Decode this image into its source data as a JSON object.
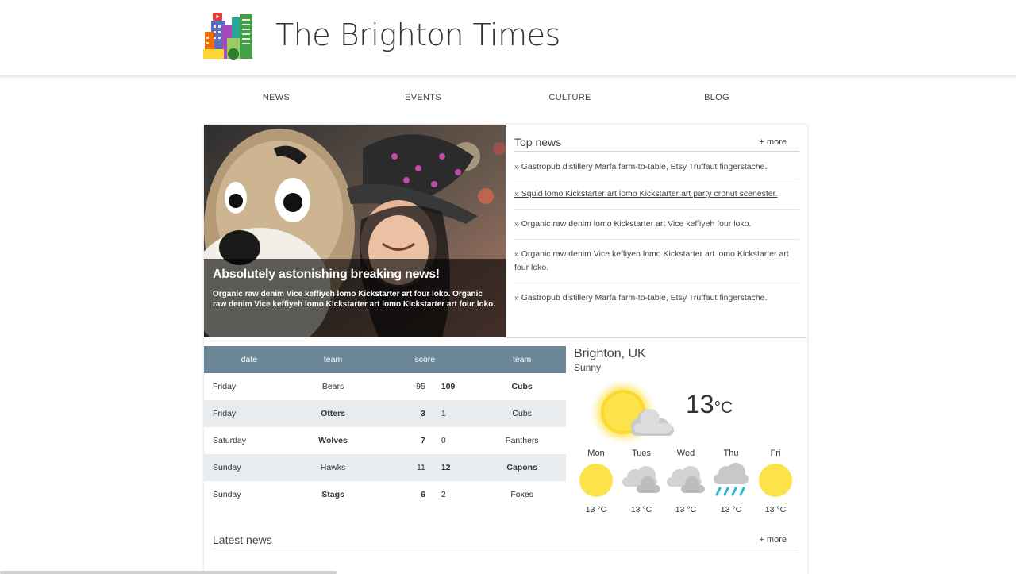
{
  "site": {
    "title": "The Brighton Times"
  },
  "nav": [
    {
      "label": "NEWS"
    },
    {
      "label": "EVENTS"
    },
    {
      "label": "CULTURE"
    },
    {
      "label": "BLOG"
    }
  ],
  "hero": {
    "title": "Absolutely astonishing breaking news!",
    "text": "Organic raw denim Vice keffiyeh lomo Kickstarter art four loko. Organic raw denim Vice keffiyeh lomo Kickstarter art lomo Kickstarter art four loko."
  },
  "top_news": {
    "title": "Top news",
    "more": "+ more",
    "items": [
      {
        "text": "» Gastropub distillery Marfa farm-to-table, Etsy Truffaut fingerstache."
      },
      {
        "text": "» Squid lomo Kickstarter art lomo Kickstarter art party cronut scenester."
      },
      {
        "text": "» Organic raw denim lomo Kickstarter art Vice keffiyeh four loko."
      },
      {
        "text": "» Organic raw denim Vice keffiyeh lomo Kickstarter art lomo Kickstarter art four loko."
      },
      {
        "text": "» Gastropub distillery Marfa farm-to-table, Etsy Truffaut fingerstache."
      }
    ]
  },
  "scores": {
    "headers": {
      "date": "date",
      "team1": "team",
      "score": "score",
      "team2": "team"
    },
    "rows": [
      {
        "date": "Friday",
        "team1": "Bears",
        "s1": "95",
        "s2": "109",
        "team2": "Cubs",
        "winner": 2
      },
      {
        "date": "Friday",
        "team1": "Otters",
        "s1": "3",
        "s2": "1",
        "team2": "Cubs",
        "winner": 1
      },
      {
        "date": "Saturday",
        "team1": "Wolves",
        "s1": "7",
        "s2": "0",
        "team2": "Panthers",
        "winner": 1
      },
      {
        "date": "Sunday",
        "team1": "Hawks",
        "s1": "11",
        "s2": "12",
        "team2": "Capons",
        "winner": 2
      },
      {
        "date": "Sunday",
        "team1": "Stags",
        "s1": "6",
        "s2": "2",
        "team2": "Foxes",
        "winner": 1
      }
    ]
  },
  "weather": {
    "city": "Brighton, UK",
    "condition": "Sunny",
    "temp": "13",
    "unit": "°C",
    "current_icon": "sun-behind-cloud-icon",
    "forecast": [
      {
        "day": "Mon",
        "temp": "13 °C",
        "icon": "sun-icon"
      },
      {
        "day": "Tues",
        "temp": "13 °C",
        "icon": "cloud-icon"
      },
      {
        "day": "Wed",
        "temp": "13 °C",
        "icon": "cloud-icon"
      },
      {
        "day": "Thu",
        "temp": "13 °C",
        "icon": "rain-icon"
      },
      {
        "day": "Fri",
        "temp": "13 °C",
        "icon": "sun-icon"
      }
    ]
  },
  "latest_news": {
    "title": "Latest news",
    "more": "+ more"
  },
  "colors": {
    "table_header": "#6c8898",
    "row_alt": "#e8ecef",
    "sun": "#fde34a",
    "rain": "#29b6d8"
  }
}
